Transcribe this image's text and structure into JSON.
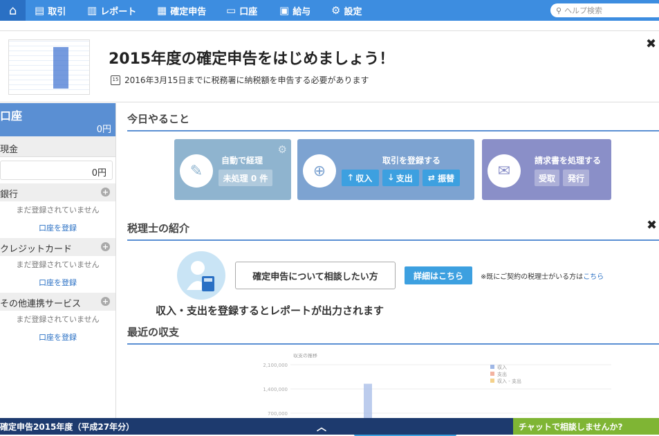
{
  "nav": {
    "items": [
      {
        "label": "取引",
        "icon": "inbox-icon",
        "glyph": "▤"
      },
      {
        "label": "レポート",
        "icon": "bar-chart-icon",
        "glyph": "▥"
      },
      {
        "label": "確定申告",
        "icon": "columns-icon",
        "glyph": "▦"
      },
      {
        "label": "口座",
        "icon": "card-icon",
        "glyph": "▭"
      },
      {
        "label": "給与",
        "icon": "calendar-icon",
        "glyph": "▣"
      },
      {
        "label": "設定",
        "icon": "gear-icon",
        "glyph": "⚙"
      }
    ],
    "search_placeholder": "ヘルプ検索"
  },
  "banner": {
    "title": "2015年度の確定申告をはじめましょう！",
    "subtitle": "2016年3月15日までに税務署に納税額を申告する必要があります",
    "calendar_day": "15"
  },
  "sidebar": {
    "title": "口座",
    "total": "0円",
    "cash_label": "現金",
    "cash_value": "0円",
    "sections": [
      {
        "label": "銀行",
        "empty": "まだ登録されていません",
        "link": "口座を登録"
      },
      {
        "label": "クレジットカード",
        "empty": "まだ登録されていません",
        "link": "口座を登録"
      },
      {
        "label": "その他連携サービス",
        "empty": "まだ登録されていません",
        "link": "口座を登録"
      }
    ]
  },
  "today": {
    "title": "今日やること",
    "auto": {
      "title": "自動で経理",
      "badge": "未処理 0 件"
    },
    "register": {
      "title": "取引を登録する",
      "income": "収入",
      "expense": "支出",
      "transfer": "振替"
    },
    "invoice": {
      "title": "請求書を処理する",
      "receive": "受取",
      "issue": "発行"
    }
  },
  "tax": {
    "title": "税理士の紹介",
    "bubble": "確定申告について相談したい方",
    "detail": "詳細はこちら",
    "note": "※既にご契約の税理士がいる方は",
    "note_link": "こちら"
  },
  "recent": {
    "title": "最近の収支",
    "message": "収入・支出を登録するとレポートが出力されます"
  },
  "chart_data": {
    "type": "bar",
    "title": "収支の推移",
    "yticks": [
      "2,100,000",
      "1,400,000",
      "700,000"
    ],
    "series": [
      {
        "name": "収入",
        "color": "#9fb7e6"
      },
      {
        "name": "支出",
        "color": "#f3b3a0"
      },
      {
        "name": "収入 - 支出",
        "color": "#f4d18a"
      }
    ],
    "values": [
      1550000
    ]
  },
  "footer": {
    "left": "確定申告2015年度（平成27年分）",
    "chat": "チャットで相談しませんか?"
  }
}
